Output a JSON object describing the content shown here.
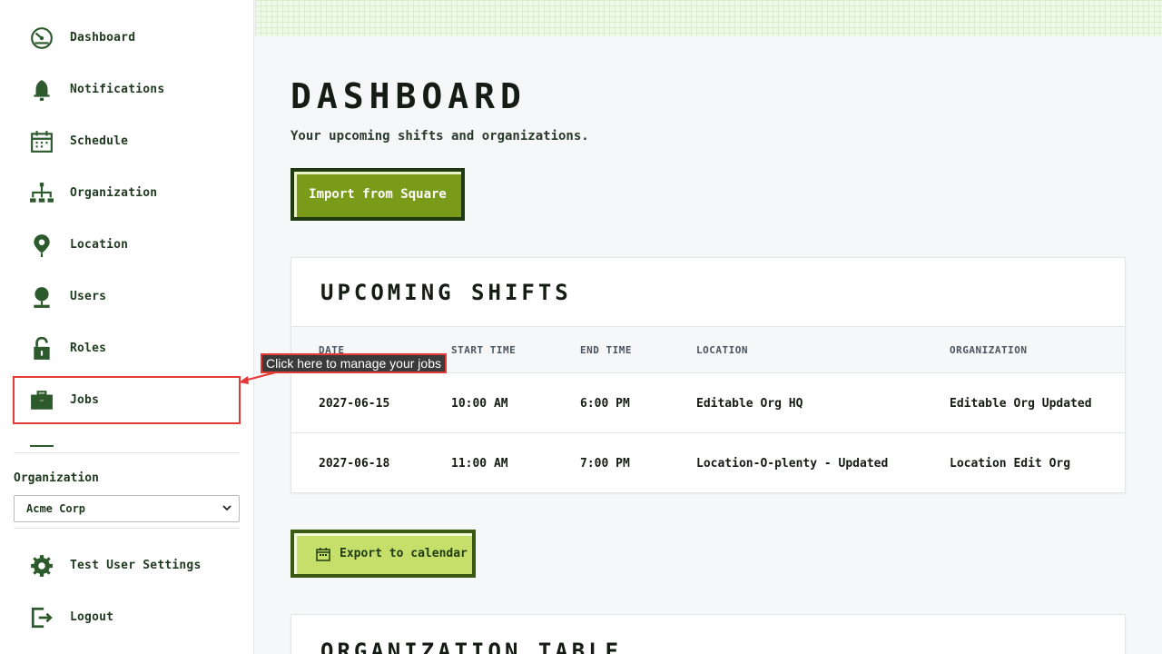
{
  "sidebar": {
    "items": [
      {
        "label": "Dashboard",
        "icon": "dashboard-icon"
      },
      {
        "label": "Notifications",
        "icon": "bell-icon"
      },
      {
        "label": "Schedule",
        "icon": "calendar-icon"
      },
      {
        "label": "Organization",
        "icon": "org-chart-icon"
      },
      {
        "label": "Location",
        "icon": "map-pin-icon"
      },
      {
        "label": "Users",
        "icon": "user-icon"
      },
      {
        "label": "Roles",
        "icon": "lock-icon"
      },
      {
        "label": "Jobs",
        "icon": "briefcase-icon"
      }
    ],
    "org_label": "Organization",
    "org_selected": "Acme Corp",
    "bottom_items": [
      {
        "label": "Test User Settings",
        "icon": "gear-icon"
      },
      {
        "label": "Logout",
        "icon": "logout-icon"
      }
    ]
  },
  "tooltip": {
    "text": "Click here to manage your jobs"
  },
  "main": {
    "title": "DASHBOARD",
    "subtitle": "Your upcoming shifts and organizations.",
    "import_button": "Import from Square",
    "shifts": {
      "title": "UPCOMING SHIFTS",
      "columns": [
        "DATE",
        "START TIME",
        "END TIME",
        "LOCATION",
        "ORGANIZATION"
      ],
      "rows": [
        [
          "2027-06-15",
          "10:00 AM",
          "6:00 PM",
          "Editable Org HQ",
          "Editable Org Updated"
        ],
        [
          "2027-06-18",
          "11:00 AM",
          "7:00 PM",
          "Location-O-plenty - Updated",
          "Location Edit Org"
        ]
      ]
    },
    "export_button": "Export to calendar",
    "org_table": {
      "title": "ORGANIZATION TABLE"
    }
  },
  "colors": {
    "accent_dark": "#1f3a10",
    "accent_button": "#7a9a1a",
    "export_button": "#c5df6a",
    "highlight": "#e53935"
  }
}
